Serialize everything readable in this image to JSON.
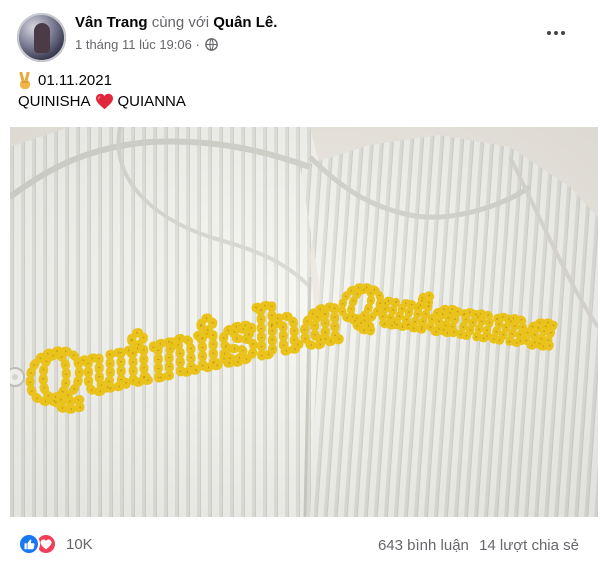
{
  "post": {
    "author": "Vân Trang",
    "with_word": "cùng với",
    "tagged": "Quân Lê.",
    "timestamp": "1 tháng 11 lúc 19:06",
    "privacy_icon": "globe-icon"
  },
  "caption": {
    "date_line": "01.11.2021",
    "name_left": "QUINISHA",
    "name_right": "QUIANNA",
    "emoji_1": "victory-hand-icon",
    "emoji_2": "red-heart-icon"
  },
  "photo": {
    "embroidery_left": "Quinisha",
    "embroidery_right": "Quianna",
    "thread_color": "#e9c21c",
    "fabric_color": "#f6f6f3"
  },
  "footer": {
    "reaction_count": "10K",
    "comments": "643 bình luận",
    "shares": "14 lượt chia sẻ"
  },
  "colors": {
    "like_blue": "#1877f2",
    "love_red": "#f33e58",
    "secondary_text": "#65676b"
  }
}
